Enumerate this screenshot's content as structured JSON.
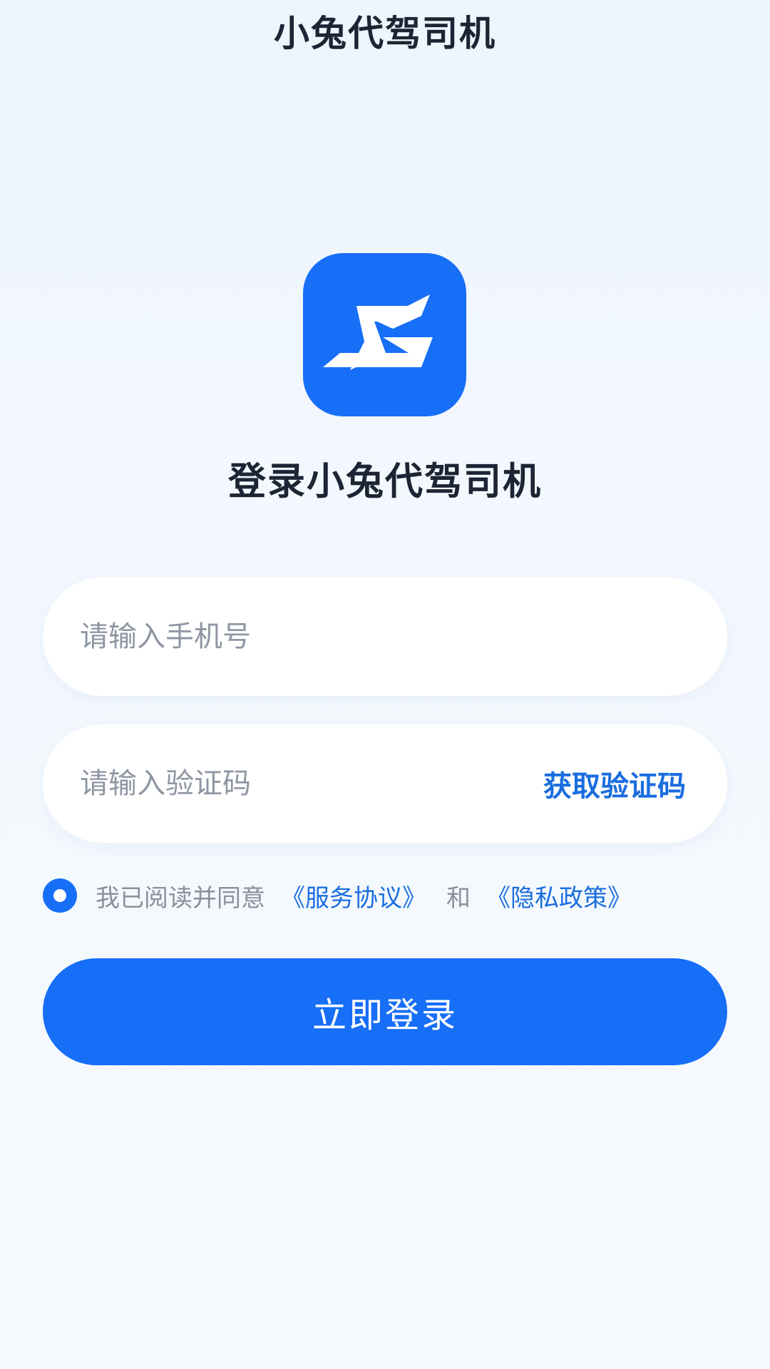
{
  "header": {
    "title": "小兔代驾司机"
  },
  "logo": {
    "icon": "app-logo-icon",
    "color": "#176ef7"
  },
  "main": {
    "heading": "登录小兔代驾司机",
    "phone_input": {
      "placeholder": "请输入手机号",
      "value": ""
    },
    "code_input": {
      "placeholder": "请输入验证码",
      "value": ""
    },
    "get_code_label": "获取验证码",
    "agreement": {
      "checked": true,
      "prefix": "我已阅读并同意",
      "service_link": "《服务协议》",
      "conjunction": "和",
      "privacy_link": "《隐私政策》"
    },
    "login_button_label": "立即登录"
  },
  "colors": {
    "accent": "#176ef7",
    "link": "#1a6ddf",
    "title": "#1d2433",
    "placeholder": "#8f96a3"
  }
}
